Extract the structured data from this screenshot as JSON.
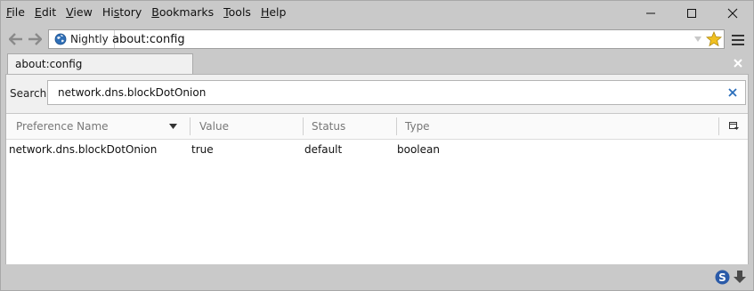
{
  "menu": [
    {
      "label": "File",
      "accel": "F",
      "rest": "ile"
    },
    {
      "label": "Edit",
      "accel": "E",
      "rest": "dit"
    },
    {
      "label": "View",
      "accel": "V",
      "rest": "iew"
    },
    {
      "label": "History",
      "accel": "",
      "pre": "Hi",
      "mid": "s",
      "rest": "tory"
    },
    {
      "label": "Bookmarks",
      "accel": "B",
      "rest": "ookmarks"
    },
    {
      "label": "Tools",
      "accel": "T",
      "rest": "ools"
    },
    {
      "label": "Help",
      "accel": "H",
      "rest": "elp"
    }
  ],
  "identity": {
    "label": "Nightly"
  },
  "url": "about:config",
  "tab": {
    "label": "about:config"
  },
  "search": {
    "label": "Search:",
    "value": "network.dns.blockDotOnion"
  },
  "columns": {
    "name": "Preference Name",
    "value": "Value",
    "status": "Status",
    "type": "Type"
  },
  "rows": [
    {
      "name": "network.dns.blockDotOnion",
      "value": "true",
      "status": "default",
      "type": "boolean"
    }
  ],
  "colors": {
    "chrome": "#c9c9c9",
    "content": "#f0f0f0",
    "clear_x": "#2a6ebb",
    "star": "#f0c020"
  },
  "icons": [
    "minimize-icon",
    "maximize-icon",
    "close-icon",
    "back-arrow-icon",
    "forward-arrow-icon",
    "globe-icon",
    "dropmarker-icon",
    "bookmark-star-icon",
    "hamburger-menu-icon",
    "tab-close-icon",
    "search-clear-icon",
    "sort-arrow-icon",
    "column-picker-icon",
    "s-addon-icon",
    "download-icon"
  ]
}
